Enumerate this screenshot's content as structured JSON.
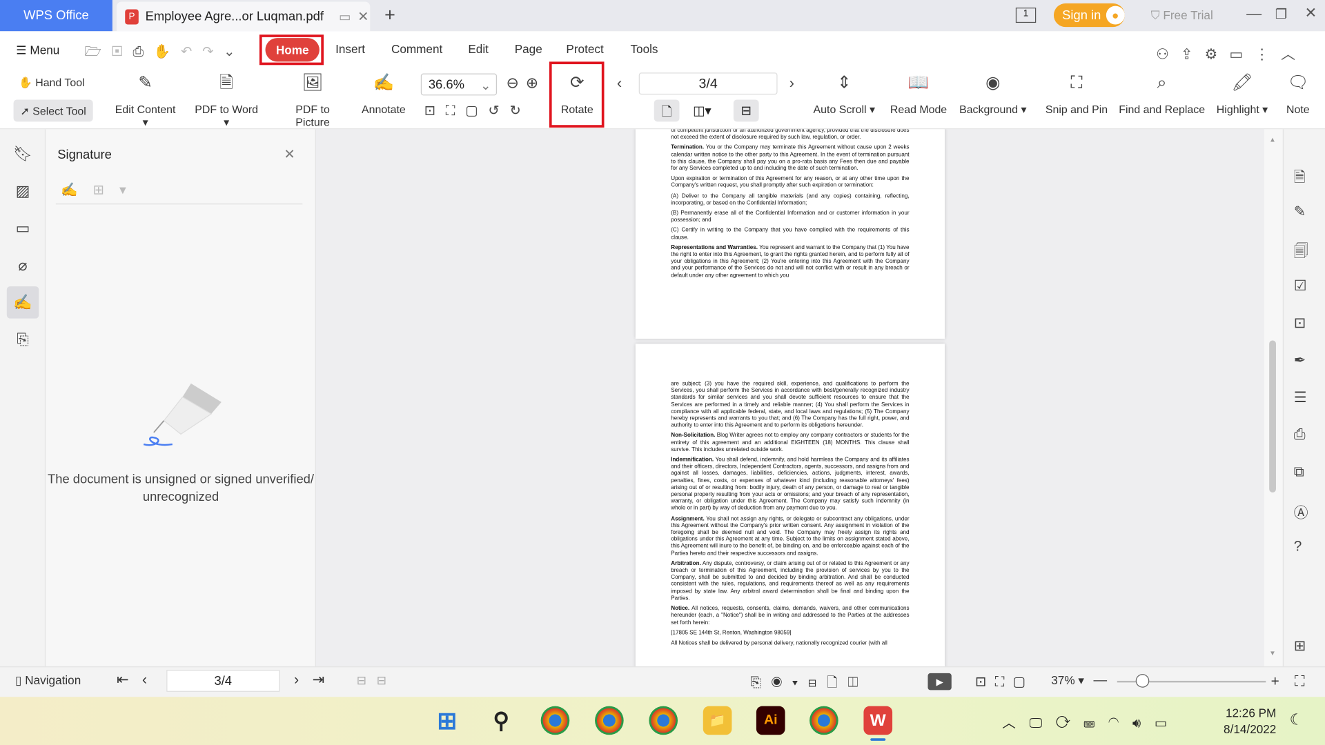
{
  "tabs": {
    "app": "WPS Office",
    "document": "Employee Agre...or Luqman.pdf",
    "new_tab": "+"
  },
  "titlebar": {
    "sign_in": "Sign in",
    "free_trial": "Free Trial",
    "badge": "1"
  },
  "menu": {
    "menu": "Menu",
    "items": [
      "Home",
      "Insert",
      "Comment",
      "Edit",
      "Page",
      "Protect",
      "Tools"
    ]
  },
  "toolbar": {
    "hand_tool": "Hand Tool",
    "select_tool": "Select Tool",
    "edit_content": "Edit Content",
    "pdf_to_word": "PDF to Word",
    "pdf_to_picture": "PDF to Picture",
    "annotate": "Annotate",
    "zoom": "36.6%",
    "rotate": "Rotate",
    "page": "3/4",
    "auto_scroll": "Auto Scroll",
    "read_mode": "Read Mode",
    "background": "Background",
    "snip_and_pin": "Snip and Pin",
    "find_and_replace": "Find and Replace",
    "highlight": "Highlight",
    "note": "Note"
  },
  "panel": {
    "title": "Signature",
    "message": "The document is unsigned or signed unverified/ unrecognized"
  },
  "page3": [
    {
      "b": "",
      "t": "of competent jurisdiction or an authorized government agency, provided that the disclosure does not exceed the extent of disclosure required by such law, regulation, or order."
    },
    {
      "b": "Termination.",
      "t": " You or the Company may terminate this Agreement without cause upon 2 weeks calendar written notice to the other party to this Agreement. In the event of termination pursuant to this clause, the Company shall pay you on a pro-rata basis any Fees then due and payable for any Services completed up to and including the date of such termination."
    },
    {
      "b": "",
      "t": "Upon expiration or termination of this Agreement for any reason, or at any other time upon the Company's written request, you shall promptly after such expiration or termination:"
    },
    {
      "b": "",
      "t": "(A)   Deliver to the Company all tangible materials (and any copies) containing, reflecting, incorporating, or based on the Confidential Information;"
    },
    {
      "b": "",
      "t": "(B)  Permanently erase all of the Confidential Information and or customer information in your possession; and"
    },
    {
      "b": "",
      "t": "(C)  Certify in writing to the Company that you have complied with the requirements of this clause."
    },
    {
      "b": "Representations and Warranties.",
      "t": " You represent and warrant to the Company that (1) You have the right to enter into this Agreement, to grant the rights granted herein, and to perform fully all of your obligations in this Agreement; (2) You're entering into this Agreement with the Company and your performance of the Services do not and will not conflict with or result in any breach or default under any other agreement to which you"
    }
  ],
  "page4": [
    {
      "b": "",
      "t": "are subject; (3) you have the required skill, experience, and qualifications to perform the Services, you shall perform the Services in accordance with best/generally recognized industry standards for similar services and you shall devote sufficient resources to ensure that the Services are performed in a timely and reliable manner; (4) You shall perform the Services in compliance with all applicable federal, state, and local laws and regulations; (5) The Company hereby represents and warrants to you that; and (6) The Company has the full right, power, and authority to enter into this Agreement and to perform its obligations hereunder."
    },
    {
      "b": "Non-Solicitation.",
      "t": " Blog Writer agrees not to employ any company contractors or students for the entirety of this agreement and an additional EIGHTEEN (18) MONTHS. This clause shall survive. This includes unrelated outside work."
    },
    {
      "b": "Indemnification.",
      "t": " You shall defend, indemnify, and hold harmless the Company and its affiliates and their officers, directors, Independent Contractors, agents, successors, and assigns from and against all losses, damages, liabilities, deficiencies, actions, judgments, interest, awards, penalties, fines, costs, or expenses of whatever kind (including reasonable attorneys' fees) arising out of or resulting from: bodily injury, death of any person, or damage to real or tangible personal property resulting from your acts or omissions; and your breach of any representation, warranty, or obligation under this Agreement. The Company may satisfy such indemnity (in whole or in part) by way of deduction from any payment due to you."
    },
    {
      "b": "Assignment.",
      "t": " You shall not assign any rights, or delegate or subcontract any obligations, under this Agreement without the Company's prior written consent. Any assignment in violation of the foregoing shall be deemed null and void. The Company may freely assign its rights and obligations under this Agreement at any time. Subject to the limits on assignment stated above, this Agreement will inure to the benefit of, be binding on, and be enforceable against each of the Parties hereto and their respective successors and assigns."
    },
    {
      "b": "Arbitration.",
      "t": " Any dispute, controversy, or claim arising out of or related to this Agreement or any breach or termination of this Agreement, including the provision of services by you to the Company, shall be submitted to and decided by binding arbitration. And shall be conducted consistent with the rules, regulations, and requirements thereof as well as any requirements imposed by state law. Any arbitral award determination shall be final and binding upon the Parties."
    },
    {
      "b": "Notice.",
      "t": " All notices, requests, consents, claims, demands, waivers, and other communications hereunder (each, a \"Notice\") shall be in writing and addressed to the Parties at the addresses set forth herein:"
    },
    {
      "b": "",
      "t": "         [17805 SE 144th St, Renton, Washington 98059]"
    },
    {
      "b": "",
      "t": "All Notices shall be delivered by personal delivery, nationally recognized courier (with all"
    }
  ],
  "statusbar": {
    "navigation": "Navigation",
    "page": "3/4",
    "zoom": "37%"
  },
  "taskbar": {
    "time": "12:26 PM",
    "date": "8/14/2022"
  },
  "colors": {
    "accent": "#e0413b",
    "wps_blue": "#4a7ef2",
    "sign_in": "#f5a623",
    "highlight_box": "#e0141e"
  }
}
